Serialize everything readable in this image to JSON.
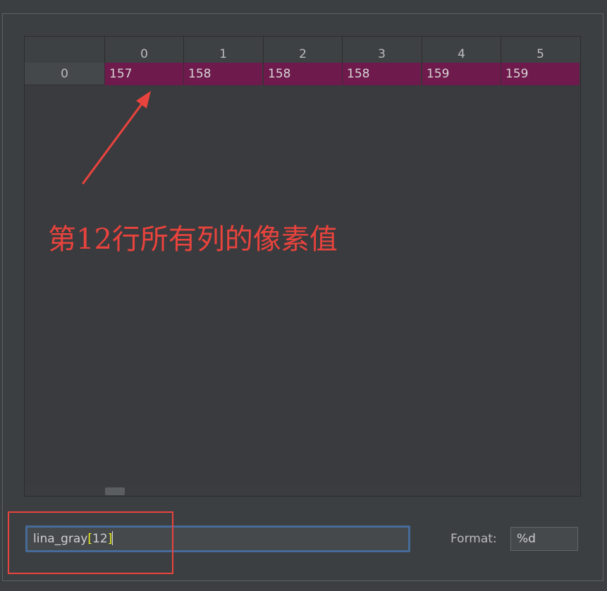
{
  "table": {
    "columns": [
      "0",
      "1",
      "2",
      "3",
      "4",
      "5"
    ],
    "rows": [
      {
        "index": "0",
        "values": [
          "157",
          "158",
          "158",
          "158",
          "159",
          "159"
        ]
      }
    ]
  },
  "annotation": {
    "text": "第12行所有列的像素值",
    "color": "#e9433d"
  },
  "expression": {
    "name": "lina_gray",
    "open_bracket": "[",
    "index": "12",
    "close_bracket": "]"
  },
  "format": {
    "label": "Format:",
    "value": "%d"
  },
  "colors": {
    "cell_highlight": "#6e1a4c",
    "input_focus_border": "#466b98",
    "bracket_match": "#f2f21e"
  }
}
